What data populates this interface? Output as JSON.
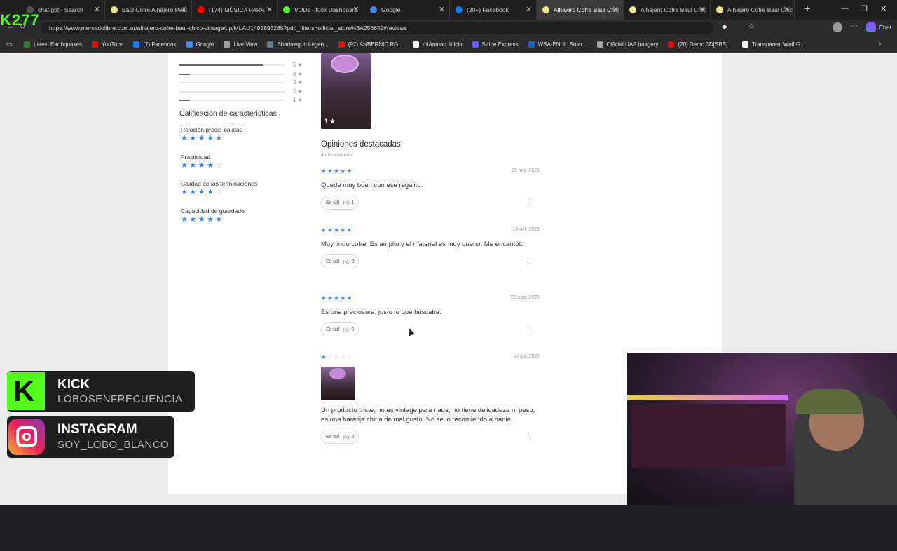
{
  "browser": {
    "tabs": [
      {
        "label": "chat gpt - Search",
        "color": "#555555",
        "active": false
      },
      {
        "label": "Baúl Cofre Alhajero Pirat",
        "color": "#f0e68c",
        "active": false
      },
      {
        "label": "(174) MÚSICA PARA",
        "color": "#ff0000",
        "active": false
      },
      {
        "label": "VODs - Kick Dashboard",
        "color": "#53fc18",
        "active": false
      },
      {
        "label": "Google",
        "color": "#4285f4",
        "active": false
      },
      {
        "label": "(20+) Facebook",
        "color": "#1877f2",
        "active": false
      },
      {
        "label": "Alhajero Cofre Baul Chic",
        "color": "#f0e68c",
        "active": true
      },
      {
        "label": "Alhajero Cofre Baul Chic",
        "color": "#f0e68c",
        "active": false
      },
      {
        "label": "Alhajero Cofre Baul Chic",
        "color": "#f0e68c",
        "active": false
      }
    ],
    "url": "https://www.mercadolibre.com.ar/alhajero-cofre-baul-chico-vintage/up/MLAU1495896285?pdp_filters=official_store%3A256642#reviews",
    "chat_label": "Chat",
    "bookmarks": [
      {
        "label": "Latest Earthquakes",
        "color": "#2e7d32"
      },
      {
        "label": "YouTube",
        "color": "#ff0000"
      },
      {
        "label": "(7) Facebook",
        "color": "#1877f2"
      },
      {
        "label": "Google",
        "color": "#4285f4"
      },
      {
        "label": "Live View",
        "color": "#9e9e9e"
      },
      {
        "label": "Shadowgun Legen...",
        "color": "#607d8b"
      },
      {
        "label": "(97) ANBERNIC RG...",
        "color": "#ff0000"
      },
      {
        "label": "miAnmac. Inicio",
        "color": "#ffffff"
      },
      {
        "label": "Stripe Express",
        "color": "#635bff"
      },
      {
        "label": "WSA-ENLIL Solar...",
        "color": "#1565c0"
      },
      {
        "label": "Official UAP Imagery",
        "color": "#9e9e9e"
      },
      {
        "label": "(20) Demo 3D[SBS]...",
        "color": "#ff0000"
      },
      {
        "label": "Transparent Wolf G...",
        "color": "#ffffff"
      }
    ]
  },
  "histogram": [
    {
      "label": "5",
      "fill": 0.8
    },
    {
      "label": "4",
      "fill": 0.1
    },
    {
      "label": "3",
      "fill": 0.0
    },
    {
      "label": "2",
      "fill": 0.0
    },
    {
      "label": "1",
      "fill": 0.1
    }
  ],
  "features": {
    "title": "Calificación de características",
    "items": [
      {
        "name": "Relación precio-calidad",
        "rating": 4.5
      },
      {
        "name": "Practicidad",
        "rating": 4
      },
      {
        "name": "Calidad de las terminaciones",
        "rating": 4
      },
      {
        "name": "Capacidad de guardado",
        "rating": 4.5
      }
    ]
  },
  "photo_badge": "1 ★",
  "opinions": {
    "title": "Opiniones destacadas",
    "count": "4 comentarios",
    "helpful_label": "Es útil",
    "reviews": [
      {
        "stars": 5,
        "date": "25 nov. 2025",
        "text": "Quede muy buen con ese regalito.",
        "helpful": "1",
        "has_image": false
      },
      {
        "stars": 5,
        "date": "14 oct. 2025",
        "text": "Muy lindo cofre. Es amplio y el material es muy bueno. Me encantó!.",
        "helpful": "0",
        "has_image": false
      },
      {
        "stars": 5,
        "date": "03 ago. 2025",
        "text": "Es una preciosura, justo lo que buscaba.",
        "helpful": "0",
        "has_image": false
      },
      {
        "stars": 1,
        "date": "24 jul. 2025",
        "text": "Un producto triste, no es vintage para nada, no tiene delicadeza ni peso, es una baratija china de mal gusto. No se lo recomiendo a nadie.",
        "helpful": "2",
        "has_image": true
      }
    ]
  },
  "overlay": {
    "k_label": "K277",
    "kick_title": "KICK",
    "kick_user": "LOBOSENFRECUENCIA",
    "ig_title": "INSTAGRAM",
    "ig_user": "SOY_LOBO_BLANCO"
  }
}
